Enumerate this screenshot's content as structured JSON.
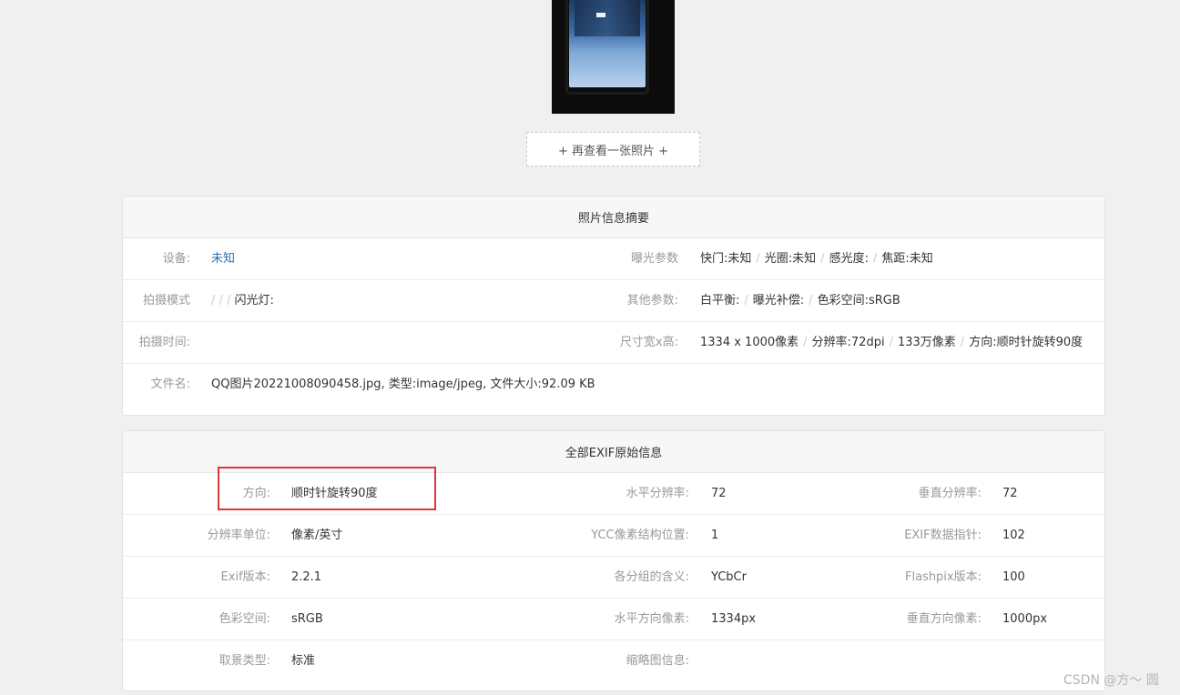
{
  "more_button": "+ 再查看一张照片 +",
  "summary": {
    "title": "照片信息摘要",
    "device_label": "设备:",
    "device_value": "未知",
    "exposure_label": "曝光参数",
    "shutter": "快门:未知",
    "aperture": "光圈:未知",
    "iso": "感光度:",
    "focal": "焦距:未知",
    "mode_label": "拍摄模式",
    "mode_seps": "/ / /",
    "flash": "闪光灯:",
    "other_label": "其他参数:",
    "white_balance": "白平衡:",
    "exposure_comp": "曝光补偿:",
    "color_space": "色彩空间:sRGB",
    "time_label": "拍摄时间:",
    "size_label": "尺寸宽x高:",
    "dimensions": "1334 x 1000像素",
    "resolution": "分辨率:72dpi",
    "megapixels": "133万像素",
    "orientation": "方向:顺时针旋转90度",
    "filename_label": "文件名:",
    "filename_value": "QQ图片20221008090458.jpg, 类型:image/jpeg, 文件大小:92.09 KB"
  },
  "exif": {
    "title": "全部EXIF原始信息",
    "rows": [
      [
        [
          "方向:",
          "顺时针旋转90度"
        ],
        [
          "水平分辨率:",
          "72"
        ],
        [
          "垂直分辨率:",
          "72"
        ]
      ],
      [
        [
          "分辨率单位:",
          "像素/英寸"
        ],
        [
          "YCC像素结构位置:",
          "1"
        ],
        [
          "EXIF数据指针:",
          "102"
        ]
      ],
      [
        [
          "Exif版本:",
          "2.2.1"
        ],
        [
          "各分组的含义:",
          "YCbCr"
        ],
        [
          "Flashpix版本:",
          "100"
        ]
      ],
      [
        [
          "色彩空间:",
          "sRGB"
        ],
        [
          "水平方向像素:",
          "1334px"
        ],
        [
          "垂直方向像素:",
          "1000px"
        ]
      ],
      [
        [
          "取景类型:",
          "标准"
        ],
        [
          "缩略图信息:",
          ""
        ],
        [
          "",
          ""
        ]
      ]
    ]
  },
  "watermark": "CSDN @方～ 圆",
  "colors": {
    "link": "#2d6fb4",
    "highlight": "#e0353b",
    "background": "#f0f0f0"
  }
}
